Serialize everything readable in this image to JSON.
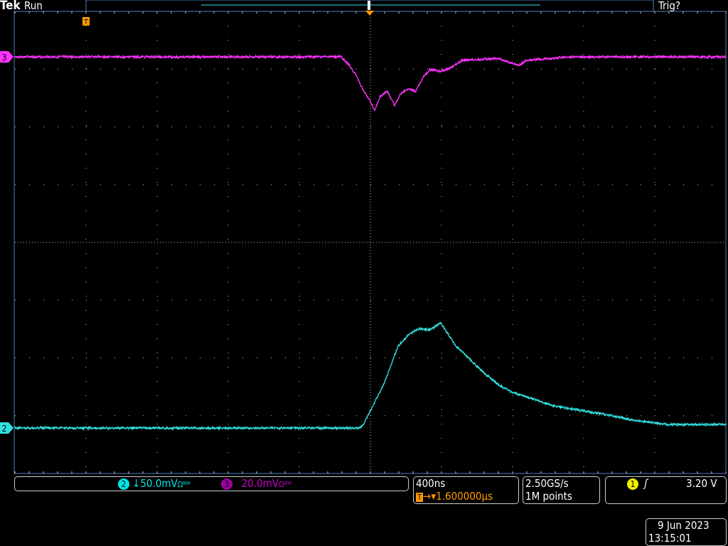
{
  "header": {
    "brand": "Tek",
    "state": "Run",
    "trigger_status": "Trig?"
  },
  "channels": [
    {
      "id": "2",
      "label": "2",
      "scale": "50.0mV",
      "coupling_icons": "Ωᴮᵂ",
      "offset_icon": "arrow-down",
      "color": "#00e5e5"
    },
    {
      "id": "3",
      "label": "3",
      "scale": "20.0mV",
      "coupling_icons": "Ωᴮᵂ",
      "color": "#cc00cc"
    }
  ],
  "timebase": {
    "scale": "400ns",
    "delay": "1.600000µs",
    "trigger_icon": "T"
  },
  "acquisition": {
    "sample_rate": "2.50GS/s",
    "record_length": "1M points"
  },
  "trigger": {
    "source": "1",
    "slope": "rising",
    "level": "3.20 V",
    "color": "#f0f000"
  },
  "datetime": {
    "date": "9 Jun 2023",
    "time": "13:15:01"
  },
  "colors": {
    "trigger_marker": "#ff9900",
    "grid": "#cccccc",
    "frame": "#4a7fbf"
  },
  "chart_data": {
    "type": "line",
    "xlabel": "",
    "ylabel": "",
    "x_units": "µs from trigger",
    "xlim": [
      -0.4,
      3.6
    ],
    "divisions": {
      "x": 10,
      "y": 8
    },
    "grid": true,
    "series": [
      {
        "channel": "3",
        "units": "mV",
        "volts_per_div": 20,
        "color": "#ff33ff",
        "x": [
          -0.4,
          1.436,
          1.476,
          1.516,
          1.556,
          1.596,
          1.624,
          1.656,
          1.696,
          1.736,
          1.776,
          1.816,
          1.856,
          1.896,
          1.936,
          1.996,
          2.056,
          2.116,
          2.316,
          2.436,
          2.476,
          2.716,
          3.6
        ],
        "y": [
          0,
          0,
          -2.5,
          -6,
          -11,
          -15,
          -18.5,
          -13.6,
          -11.9,
          -16.8,
          -12.3,
          -11,
          -12,
          -7,
          -4.4,
          -5,
          -3.7,
          -1.2,
          -0.5,
          -3,
          -1.2,
          0,
          0
        ]
      },
      {
        "channel": "2",
        "units": "mV",
        "volts_per_div": 50,
        "color": "#33e0e0",
        "x": [
          -0.4,
          1.536,
          1.556,
          1.596,
          1.676,
          1.756,
          1.816,
          1.876,
          1.936,
          1.996,
          2.076,
          2.156,
          2.236,
          2.316,
          2.396,
          2.476,
          2.636,
          2.796,
          2.956,
          3.116,
          3.276,
          3.6
        ],
        "y": [
          0,
          0,
          2,
          13.6,
          38,
          71,
          81,
          86,
          85,
          91,
          72,
          60,
          48,
          38,
          31,
          27,
          19,
          15,
          10.5,
          6,
          3,
          3
        ]
      }
    ]
  }
}
